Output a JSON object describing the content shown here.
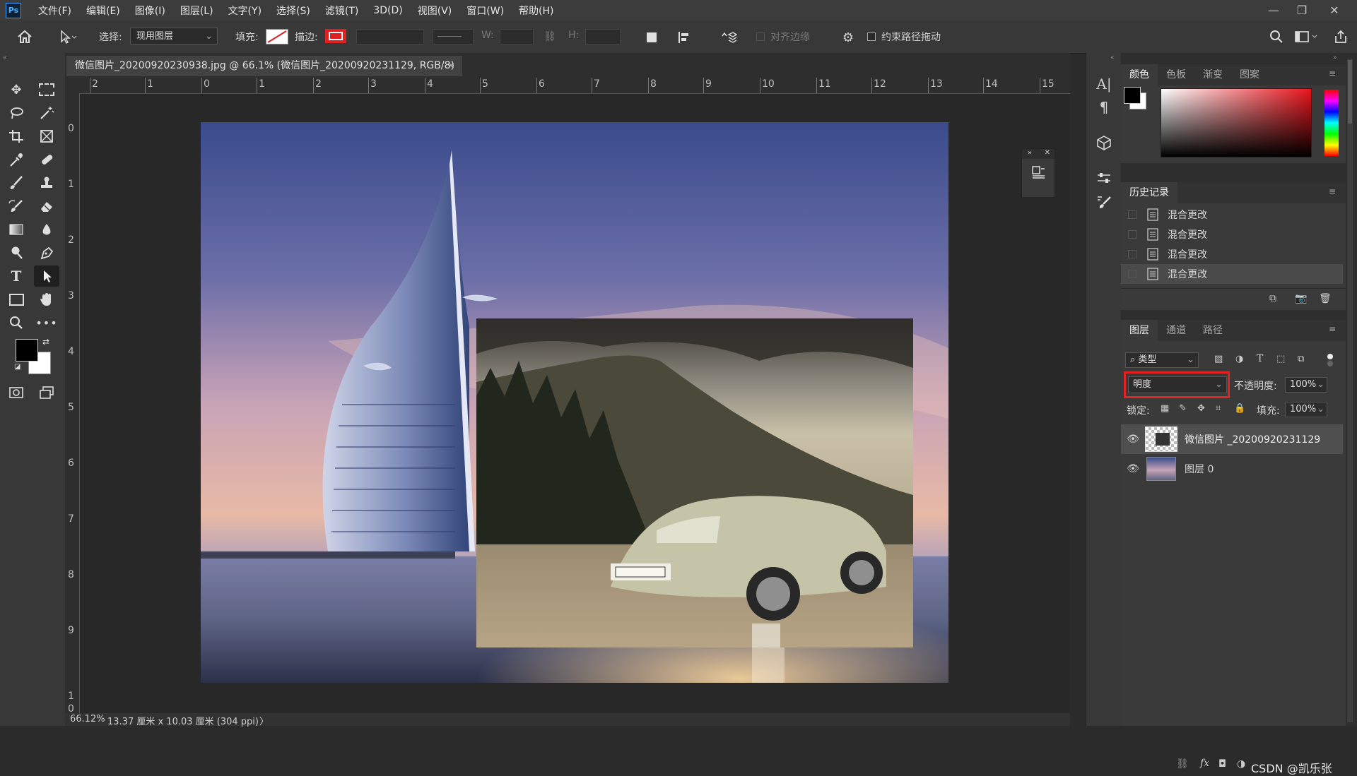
{
  "menubar": {
    "logo": "Ps",
    "items": [
      "文件(F)",
      "编辑(E)",
      "图像(I)",
      "图层(L)",
      "文字(Y)",
      "选择(S)",
      "滤镜(T)",
      "3D(D)",
      "视图(V)",
      "窗口(W)",
      "帮助(H)"
    ]
  },
  "options": {
    "select_label": "选择:",
    "select_value": "现用图层",
    "fill_label": "填充:",
    "stroke_label": "描边:",
    "w_label": "W:",
    "h_label": "H:",
    "align_edges": "对齐边缘",
    "constrain_path": "约束路径拖动"
  },
  "document": {
    "tab_title": "微信图片_20200920230938.jpg @ 66.1% (微信图片_20200920231129, RGB/8) *",
    "close": "×"
  },
  "rulers": {
    "top": [
      "2",
      "1",
      "0",
      "1",
      "2",
      "3",
      "4",
      "5",
      "6",
      "7",
      "8",
      "9",
      "10",
      "11",
      "12",
      "13",
      "14",
      "15"
    ],
    "left": [
      "0",
      "1",
      "2",
      "3",
      "4",
      "5",
      "6",
      "7",
      "8",
      "9",
      "1",
      "0"
    ]
  },
  "status": {
    "zoom": "66.12%",
    "info": "13.37 厘米 x 10.03 厘米 (304 ppi)",
    "arrow": "〉"
  },
  "color_panel": {
    "tabs": [
      "颜色",
      "色板",
      "渐变",
      "图案"
    ],
    "foreground": "#000000",
    "background": "#ffffff",
    "hue_base": "#e8141c"
  },
  "history_panel": {
    "title": "历史记录",
    "items": [
      "混合更改",
      "混合更改",
      "混合更改",
      "混合更改"
    ]
  },
  "layers_panel": {
    "tabs": [
      "图层",
      "通道",
      "路径"
    ],
    "filter_label": "类型",
    "blend_mode": "明度",
    "opacity_label": "不透明度:",
    "opacity_value": "100%",
    "lock_label": "锁定:",
    "fill_label": "填充:",
    "fill_value": "100%",
    "layers": [
      {
        "name": "微信图片 _20200920231129",
        "visible": true,
        "selected": true
      },
      {
        "name": "图层 0",
        "visible": true,
        "selected": false
      }
    ]
  },
  "highlight_color": "#e32222",
  "watermark": "CSDN @凯乐张"
}
